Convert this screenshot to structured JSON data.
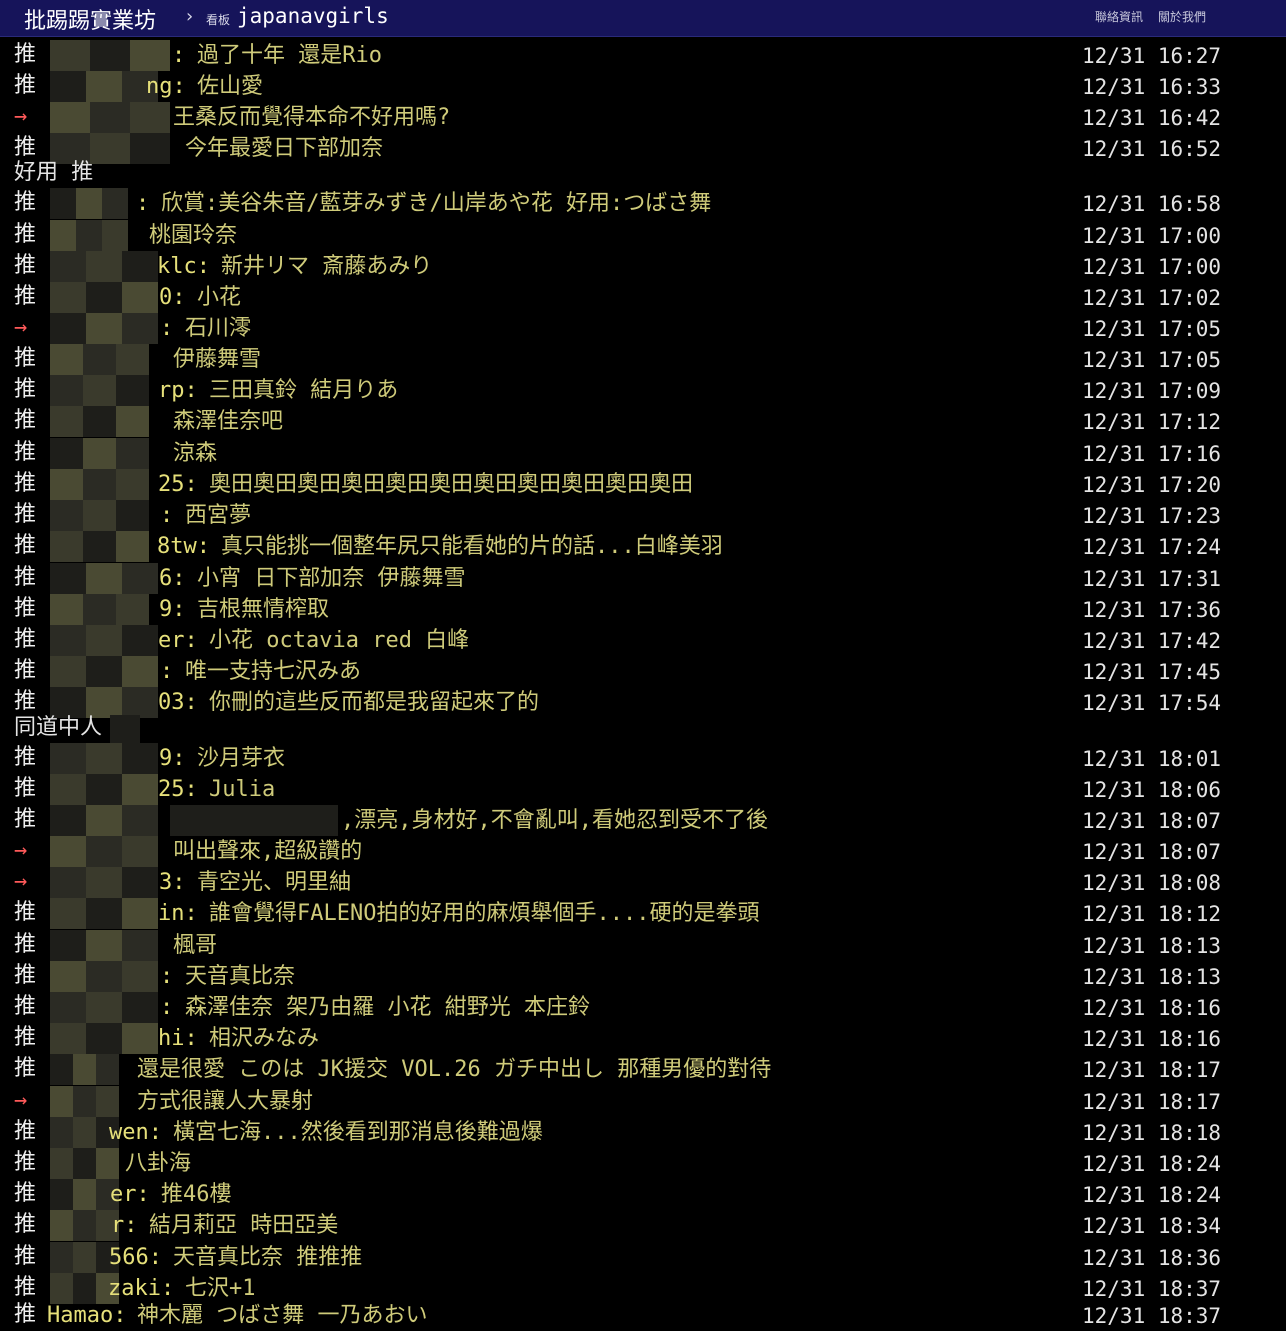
{
  "header": {
    "site_title": "批踢踢實業坊",
    "separator": "›",
    "board_label": "看板",
    "board_name": "japanavgirls",
    "contact_link": "聯絡資訊",
    "about_link": "關於我們"
  },
  "comments": [
    {
      "tag": "推",
      "uid": ":",
      "content": "過了十年 還是Rio",
      "time": "12/31 16:27"
    },
    {
      "tag": "推",
      "uid": "ng:",
      "content": "佐山愛",
      "time": "12/31 16:33"
    },
    {
      "tag": "→",
      "uid": "",
      "content": "王桑反而覺得本命不好用嗎?",
      "time": "12/31 16:42"
    },
    {
      "tag": "推",
      "uid": "",
      "content": "今年最愛日下部加奈",
      "time": "12/31 16:52"
    },
    {
      "plain": "好用 推"
    },
    {
      "tag": "推",
      "uid": ":",
      "content": "欣賞:美谷朱音/藍芽みずき/山岸あや花 好用:つばさ舞",
      "time": "12/31 16:58"
    },
    {
      "tag": "推",
      "uid": "",
      "content": "桃園玲奈",
      "time": "12/31 17:00"
    },
    {
      "tag": "推",
      "uid": "klc:",
      "content": "新井リマ 斎藤あみり",
      "time": "12/31 17:00"
    },
    {
      "tag": "推",
      "uid": "0:",
      "content": "小花",
      "time": "12/31 17:02"
    },
    {
      "tag": "→",
      "uid": ":",
      "content": "石川澪",
      "time": "12/31 17:05"
    },
    {
      "tag": "推",
      "uid": "",
      "content": "伊藤舞雪",
      "time": "12/31 17:05"
    },
    {
      "tag": "推",
      "uid": "rp:",
      "content": "三田真鈴 結月りあ",
      "time": "12/31 17:09"
    },
    {
      "tag": "推",
      "uid": "",
      "content": "森澤佳奈吧",
      "time": "12/31 17:12"
    },
    {
      "tag": "推",
      "uid": "",
      "content": "涼森",
      "time": "12/31 17:16"
    },
    {
      "tag": "推",
      "uid": "25:",
      "content": "奧田奧田奧田奧田奧田奧田奧田奧田奧田奧田奧田",
      "time": "12/31 17:20"
    },
    {
      "tag": "推",
      "uid": ":",
      "content": "西宮夢",
      "time": "12/31 17:23"
    },
    {
      "tag": "推",
      "uid": "8tw:",
      "content": "真只能挑一個整年尻只能看她的片的話...白峰美羽",
      "time": "12/31 17:24"
    },
    {
      "tag": "推",
      "uid": "6:",
      "content": "小宵 日下部加奈 伊藤舞雪",
      "time": "12/31 17:31"
    },
    {
      "tag": "推",
      "uid": "9:",
      "content": "吉根無情榨取",
      "time": "12/31 17:36"
    },
    {
      "tag": "推",
      "uid": "er:",
      "content": "小花 octavia red 白峰",
      "time": "12/31 17:42"
    },
    {
      "tag": "推",
      "uid": ":",
      "content": "唯一支持七沢みあ",
      "time": "12/31 17:45"
    },
    {
      "tag": "推",
      "uid": "03:",
      "content": "你刪的這些反而都是我留起來了的",
      "time": "12/31 17:54"
    },
    {
      "plain": "同道中人"
    },
    {
      "tag": "推",
      "uid": "9:",
      "content": "沙月芽衣",
      "time": "12/31 18:01"
    },
    {
      "tag": "推",
      "uid": "25:",
      "content": "Julia",
      "time": "12/31 18:06"
    },
    {
      "tag": "推",
      "uid": "",
      "content": ",漂亮,身材好,不會亂叫,看她忍到受不了後",
      "time": "12/31 18:07"
    },
    {
      "tag": "→",
      "uid": "",
      "content": "叫出聲來,超級讚的",
      "time": "12/31 18:07"
    },
    {
      "tag": "→",
      "uid": "3:",
      "content": "青空光、明里紬",
      "time": "12/31 18:08"
    },
    {
      "tag": "推",
      "uid": "in:",
      "content": "誰會覺得FALENO拍的好用的麻煩舉個手....硬的是拳頭",
      "time": "12/31 18:12"
    },
    {
      "tag": "推",
      "uid": "",
      "content": "楓哥",
      "time": "12/31 18:13"
    },
    {
      "tag": "推",
      "uid": ":",
      "content": "天音真比奈",
      "time": "12/31 18:13"
    },
    {
      "tag": "推",
      "uid": ":",
      "content": "森澤佳奈 架乃由羅 小花 紺野光 本庄鈴",
      "time": "12/31 18:16"
    },
    {
      "tag": "推",
      "uid": "hi:",
      "content": "相沢みなみ",
      "time": "12/31 18:16"
    },
    {
      "tag": "推",
      "uid": "",
      "content": "還是很愛 このは JK援交 VOL.26 ガチ中出し 那種男優的對待",
      "time": "12/31 18:17"
    },
    {
      "tag": "→",
      "uid": "",
      "content": "方式很讓人大暴射",
      "time": "12/31 18:17"
    },
    {
      "tag": "推",
      "uid": "wen:",
      "content": "橫宮七海...然後看到那消息後難過爆",
      "time": "12/31 18:18"
    },
    {
      "tag": "推",
      "uid": "",
      "content": "八卦海",
      "time": "12/31 18:24"
    },
    {
      "tag": "推",
      "uid": "er:",
      "content": "推46樓",
      "time": "12/31 18:24"
    },
    {
      "tag": "推",
      "uid": "r:",
      "content": "結月莉亞 時田亞美",
      "time": "12/31 18:34"
    },
    {
      "tag": "推",
      "uid": "566:",
      "content": "天音真比奈 推推推",
      "time": "12/31 18:36"
    },
    {
      "tag": "推",
      "uid": "zaki:",
      "content": "七沢+1",
      "time": "12/31 18:37"
    },
    {
      "tag": "推",
      "uid": "Hamao:",
      "content": "神木麗 つばさ舞 一乃あおい",
      "time": "12/31 18:37"
    }
  ]
}
